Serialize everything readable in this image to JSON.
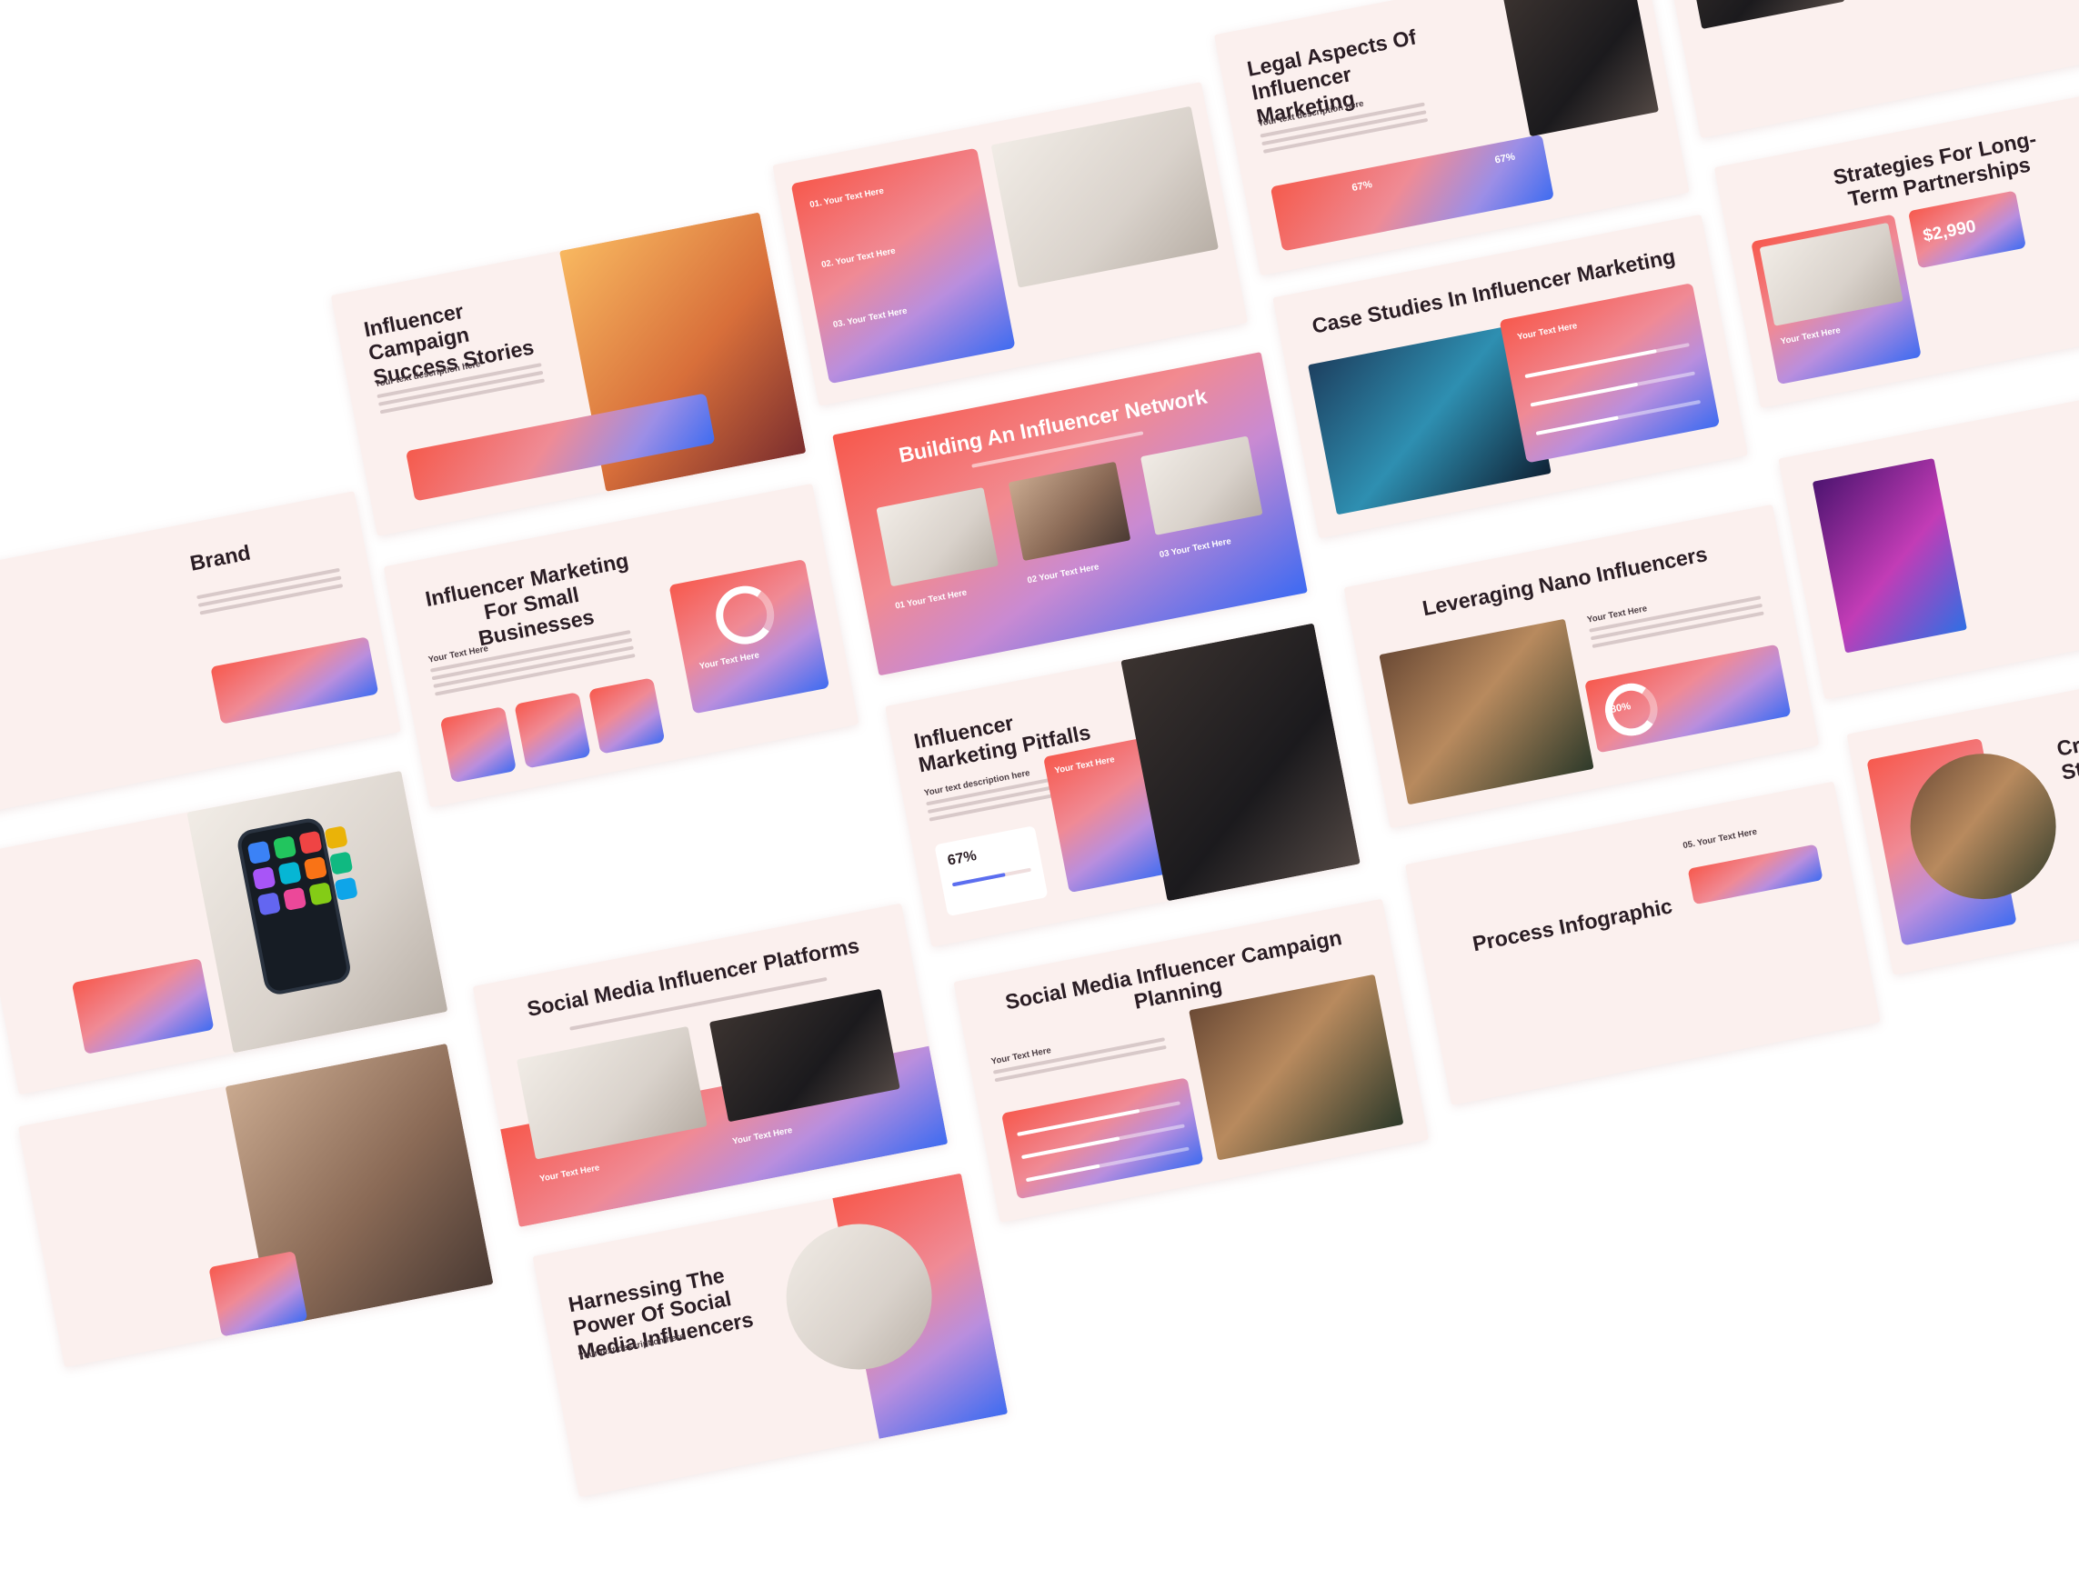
{
  "slides": {
    "campaign_success": {
      "title": "Influencer Campaign Success Stories",
      "desc_label": "Your text description here"
    },
    "small_business": {
      "title": "Influencer Marketing For Small Businesses",
      "text_label": "Your Text Here",
      "card_label": "Your Text Here"
    },
    "network": {
      "title": "Building An Influencer Network",
      "items": [
        {
          "num": "01",
          "label": "Your Text Here"
        },
        {
          "num": "02",
          "label": "Your Text Here"
        },
        {
          "num": "03",
          "label": "Your Text Here"
        }
      ]
    },
    "numbered_list": {
      "items": [
        {
          "num": "01.",
          "label": "Your Text Here"
        },
        {
          "num": "02.",
          "label": "Your Text Here"
        },
        {
          "num": "03.",
          "label": "Your Text Here"
        }
      ]
    },
    "legal": {
      "title": "Legal Aspects Of Influencer Marketing",
      "desc_label": "Your text description here",
      "stat_a": "67%",
      "stat_b": "67%"
    },
    "strategies": {
      "title": "Strategies For Long-Term Partnerships",
      "price": "$2,990",
      "text_label": "Your Text Here"
    },
    "case_studies": {
      "title": "Case Studies In Influencer Marketing",
      "card_label": "Your Text Here"
    },
    "pitfalls": {
      "title": "Influencer Marketing Pitfalls",
      "desc_label": "Your text description here",
      "pct": "67%",
      "card_label": "Your Text Here"
    },
    "platforms": {
      "title": "Social Media Influencer Platforms",
      "label": "Your Text Here"
    },
    "nano": {
      "title": "Leveraging Nano Influencers",
      "label": "Your Text Here",
      "pct": "80%"
    },
    "campaign_planning": {
      "title": "Social Media Influencer Campaign Planning",
      "label": "Your Text Here"
    },
    "harnessing": {
      "title": "Harnessing The Power Of Social Media Influencers",
      "desc_label": "Your text description here"
    },
    "process": {
      "title": "Process Infographic",
      "step_num": "05.",
      "step_label": "Your Text Here"
    },
    "brand_partial": {
      "title": "Brand"
    },
    "cr_partial": {
      "title": "Cr St"
    }
  }
}
